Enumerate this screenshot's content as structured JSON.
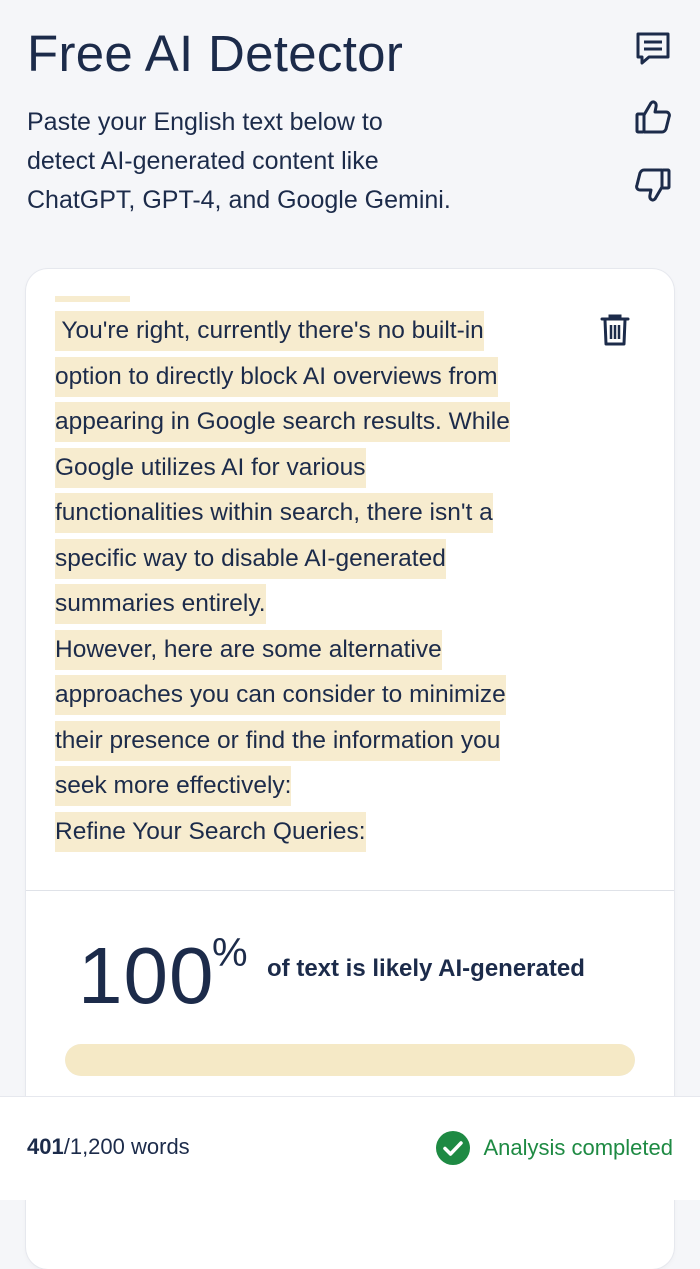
{
  "header": {
    "title": "Free AI Detector",
    "subtitle_lines": [
      "Paste your English text below to",
      "detect AI-generated content like",
      "ChatGPT, GPT-4, and Google Gemini."
    ],
    "side_icons": [
      "feedback-icon",
      "thumbs-up-icon",
      "thumbs-down-icon"
    ]
  },
  "input": {
    "lines": [
      " You're right, currently there's no built-in",
      "option to directly block AI overviews from",
      "appearing in Google search results. While",
      "Google utilizes AI for various",
      "functionalities within search, there isn't a",
      "specific way to disable AI-generated",
      "summaries entirely.",
      "However, here are some alternative",
      "approaches you can consider to minimize",
      "their presence or find the information you",
      "seek more effectively:",
      "Refine Your Search Queries:"
    ],
    "delete_icon": "trash-icon",
    "highlight_color": "#f7eccf"
  },
  "result": {
    "percent_value": "100",
    "percent_symbol": "%",
    "label": "of text is likely AI-generated",
    "progress_fraction": 1.0,
    "progress_color": "#f5e9c6"
  },
  "footer": {
    "words_used": "401",
    "words_total": "/1,200 words",
    "status_text": "Analysis completed",
    "status_icon": "check-circle-icon",
    "status_color": "#1e8a43"
  }
}
